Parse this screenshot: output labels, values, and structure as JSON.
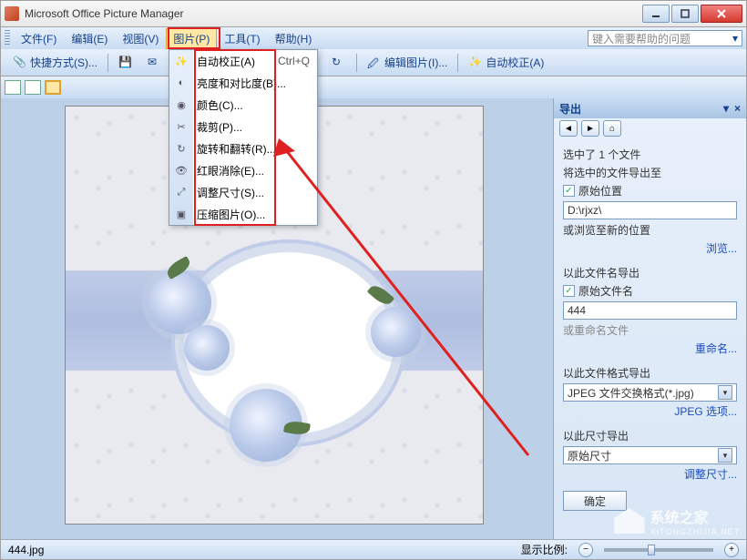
{
  "app": {
    "title": "Microsoft Office Picture Manager"
  },
  "menubar": {
    "items": [
      {
        "label": "文件(F)"
      },
      {
        "label": "编辑(E)"
      },
      {
        "label": "视图(V)"
      },
      {
        "label": "图片(P)"
      },
      {
        "label": "工具(T)"
      },
      {
        "label": "帮助(H)"
      }
    ],
    "help_placeholder": "键入需要帮助的问题"
  },
  "toolbar": {
    "shortcut": "快捷方式(S)...",
    "zoom_value": "%",
    "edit_pic": "编辑图片(I)...",
    "auto_correct": "自动校正(A)"
  },
  "dropdown": {
    "items": [
      {
        "label": "自动校正(A)",
        "shortcut": "Ctrl+Q",
        "icon": "wand"
      },
      {
        "label": "亮度和对比度(B)...",
        "icon": "contrast"
      },
      {
        "label": "颜色(C)...",
        "icon": "color"
      },
      {
        "label": "裁剪(P)...",
        "icon": "crop"
      },
      {
        "label": "旋转和翻转(R)...",
        "icon": "rotate"
      },
      {
        "label": "红眼消除(E)...",
        "icon": "redeye"
      },
      {
        "label": "调整尺寸(S)...",
        "icon": "resize"
      },
      {
        "label": "压缩图片(O)...",
        "icon": "compress"
      }
    ]
  },
  "sidebar": {
    "title": "导出",
    "selected_count": "选中了 1 个文件",
    "export_to_label": "将选中的文件导出至",
    "original_location": "原始位置",
    "path": "D:\\rjxz\\",
    "or_browse": "或浏览至新的位置",
    "browse_link": "浏览...",
    "filename_label": "以此文件名导出",
    "original_filename": "原始文件名",
    "filename_value": "444",
    "or_rename": "或重命名文件",
    "rename_link": "重命名...",
    "format_label": "以此文件格式导出",
    "format_value": "JPEG 文件交换格式(*.jpg)",
    "jpeg_options": "JPEG 选项...",
    "size_label": "以此尺寸导出",
    "size_value": "原始尺寸",
    "resize_link": "调整尺寸...",
    "ok": "确定"
  },
  "statusbar": {
    "filename": "444.jpg",
    "zoom_label": "显示比例:"
  },
  "watermark": {
    "line1": "系统之家",
    "line2": "XITONGZHIJIA.NET"
  }
}
